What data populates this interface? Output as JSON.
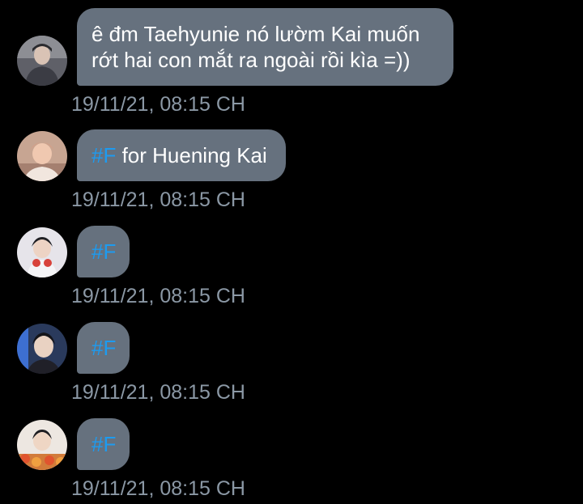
{
  "colors": {
    "background": "#000000",
    "bubble": "#66717e",
    "hashtag": "#1d9bf0",
    "timestamp": "#8b98a5",
    "message_text": "#ffffff"
  },
  "messages": [
    {
      "avatar": "user-avatar-photo",
      "text_line_1": "ê đm Taehyunie nó lườm Kai muốn",
      "text_line_2": "rớt hai con mắt ra ngoài rồi kìa =))",
      "timestamp": "19/11/21, 08:15 CH"
    },
    {
      "avatar": "user-avatar-photo",
      "hashtag": "#F",
      "text": " for Huening Kai",
      "timestamp": "19/11/21, 08:15 CH"
    },
    {
      "avatar": "user-avatar-photo",
      "hashtag": "#F",
      "timestamp": "19/11/21, 08:15 CH"
    },
    {
      "avatar": "user-avatar-photo",
      "hashtag": "#F",
      "timestamp": "19/11/21, 08:15 CH"
    },
    {
      "avatar": "user-avatar-photo",
      "hashtag": "#F",
      "timestamp": "19/11/21, 08:15 CH"
    }
  ]
}
